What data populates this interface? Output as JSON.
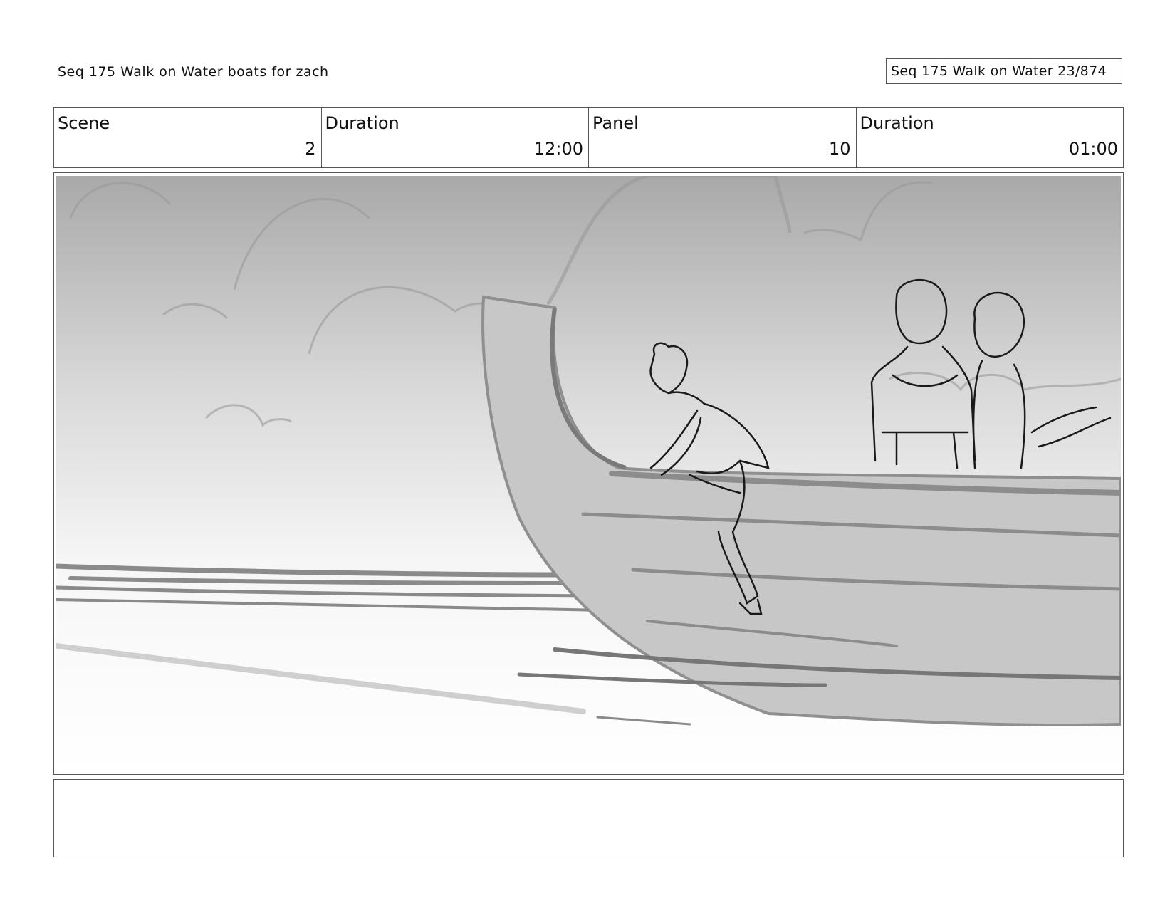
{
  "header": {
    "left_title": "Seq 175 Walk on Water  boats for zach",
    "right_title": "Seq 175 Walk on Water  23/874"
  },
  "info": {
    "scene_label": "Scene",
    "scene_value": "2",
    "scene_duration_label": "Duration",
    "scene_duration_value": "12:00",
    "panel_label": "Panel",
    "panel_value": "10",
    "panel_duration_label": "Duration",
    "panel_duration_value": "01:00"
  },
  "notes": {
    "text": ""
  }
}
